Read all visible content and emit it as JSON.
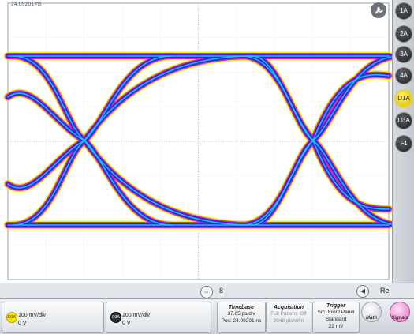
{
  "plot": {
    "timestamp": "24.09201 ns"
  },
  "channel_buttons": [
    {
      "label": "1A",
      "active": false
    },
    {
      "label": "2A",
      "active": false
    },
    {
      "label": "3A",
      "active": false
    },
    {
      "label": "4A",
      "active": false
    },
    {
      "label": "D1A",
      "active": true
    },
    {
      "label": "D3A",
      "active": false
    },
    {
      "label": "F1",
      "active": false
    }
  ],
  "hscroll": {
    "left_nav": "◀",
    "center_btn": "⇔",
    "right_nav": "▶",
    "indicator": "8"
  },
  "resbar": {
    "icon": "◀",
    "text": "Re"
  },
  "ch1": {
    "badge": "D1A",
    "scale": "100 mV/div",
    "offset": "0 V",
    "badge_color": "#f2e000"
  },
  "ch2": {
    "badge": "D3A",
    "scale": "200 mV/div",
    "offset": "0 V",
    "badge_color": "#2d2f33"
  },
  "timebase": {
    "title": "Timebase",
    "scale": "37.05 ps/div",
    "pos": "Pos: 24.09201 ns"
  },
  "acquisition": {
    "title": "Acquisition",
    "pattern": "Full Pattern: Off",
    "pts": "2048 pts/wfm"
  },
  "trigger": {
    "title": "Trigger",
    "src": "Src: Front Panel",
    "mode": "Standard",
    "level": "22 mV"
  },
  "math_btn": "Math",
  "signals_btn": "Signals",
  "colors": {
    "eye_outer": "#f2ef00",
    "eye_mid": "#cc1fd0",
    "eye_inner": "#1f2bd6",
    "eye_core": "#24c6f4"
  }
}
